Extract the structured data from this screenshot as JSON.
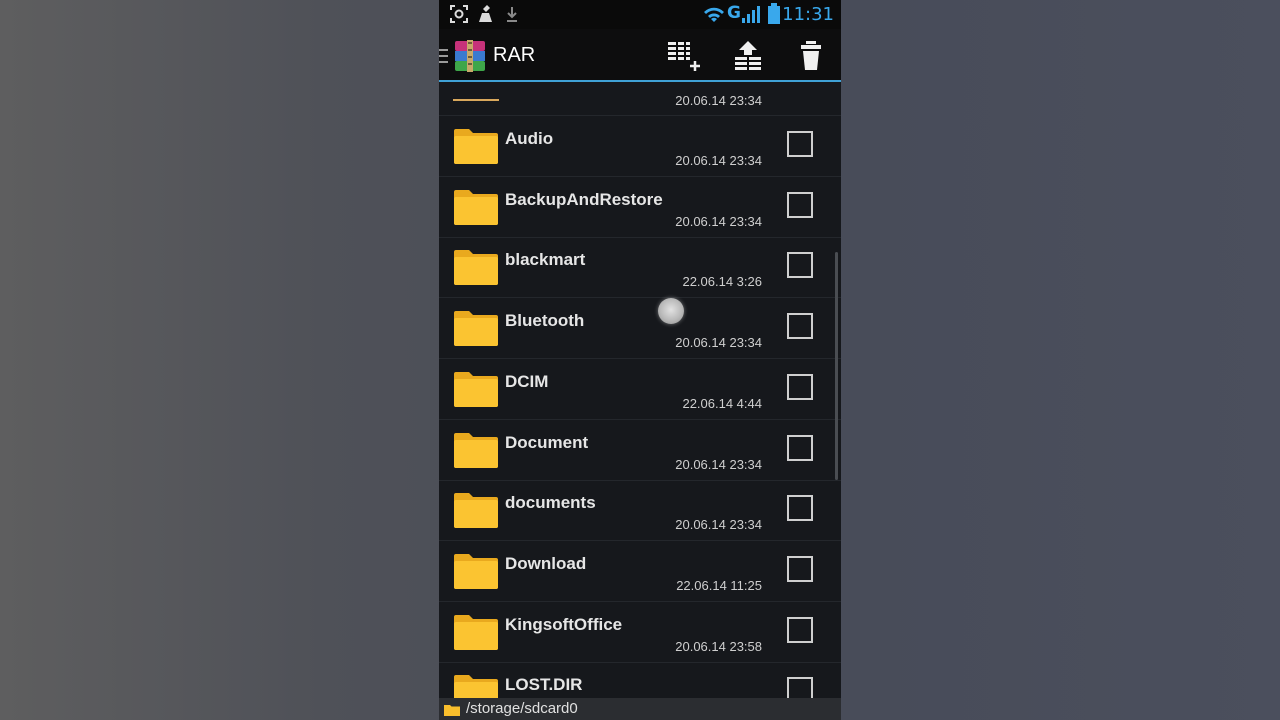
{
  "status_bar": {
    "icons": [
      "screenshot-icon",
      "cleaner-icon",
      "download-icon",
      "wifi-icon",
      "signal-icon",
      "battery-icon"
    ],
    "network_label": "G",
    "time": "11:31"
  },
  "action_bar": {
    "title": "RAR",
    "buttons": [
      "add-to-archive-icon",
      "extract-up-icon",
      "delete-icon"
    ]
  },
  "colors": {
    "accent": "#3fa1d6",
    "folder": "#f9be2c",
    "background": "#16181c"
  },
  "files": [
    {
      "name": "Audio",
      "date": "20.06.14 23:34"
    },
    {
      "name": "BackupAndRestore",
      "date": "20.06.14 23:34"
    },
    {
      "name": "blackmart",
      "date": "22.06.14 3:26"
    },
    {
      "name": "Bluetooth",
      "date": "20.06.14 23:34"
    },
    {
      "name": "DCIM",
      "date": "22.06.14 4:44"
    },
    {
      "name": "Document",
      "date": "20.06.14 23:34"
    },
    {
      "name": "documents",
      "date": "20.06.14 23:34"
    },
    {
      "name": "Download",
      "date": "22.06.14 11:25"
    },
    {
      "name": "KingsoftOffice",
      "date": "20.06.14 23:58"
    },
    {
      "name": "LOST.DIR",
      "date": ""
    }
  ],
  "partial_row": {
    "date": "20.06.14 23:34"
  },
  "path": "/storage/sdcard0"
}
